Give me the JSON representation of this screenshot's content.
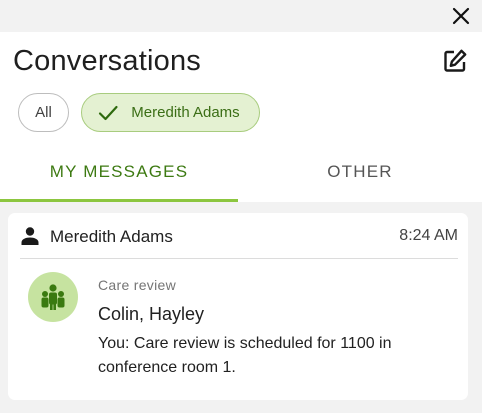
{
  "window": {
    "close_icon": "close-icon"
  },
  "header": {
    "title": "Conversations",
    "compose_icon": "compose-icon"
  },
  "filters": [
    {
      "label": "All",
      "selected": false
    },
    {
      "label": "Meredith Adams",
      "selected": true,
      "icon": "check-icon"
    }
  ],
  "tabs": [
    {
      "label": "MY MESSAGES",
      "active": true
    },
    {
      "label": "OTHER",
      "active": false
    }
  ],
  "conversations": [
    {
      "sender": "Meredith Adams",
      "sender_icon": "person-icon",
      "time": "8:24 AM",
      "avatar_icon": "group-icon",
      "subject": "Care review",
      "participants": "Colin, Hayley",
      "preview": "You: Care review is scheduled for 1100 in conference room 1."
    }
  ],
  "colors": {
    "accent": "#3d7a12",
    "tab_underline": "#8cc63f",
    "chip_selected_bg": "#e4f1d2",
    "avatar_bg": "#c6e3a0"
  }
}
